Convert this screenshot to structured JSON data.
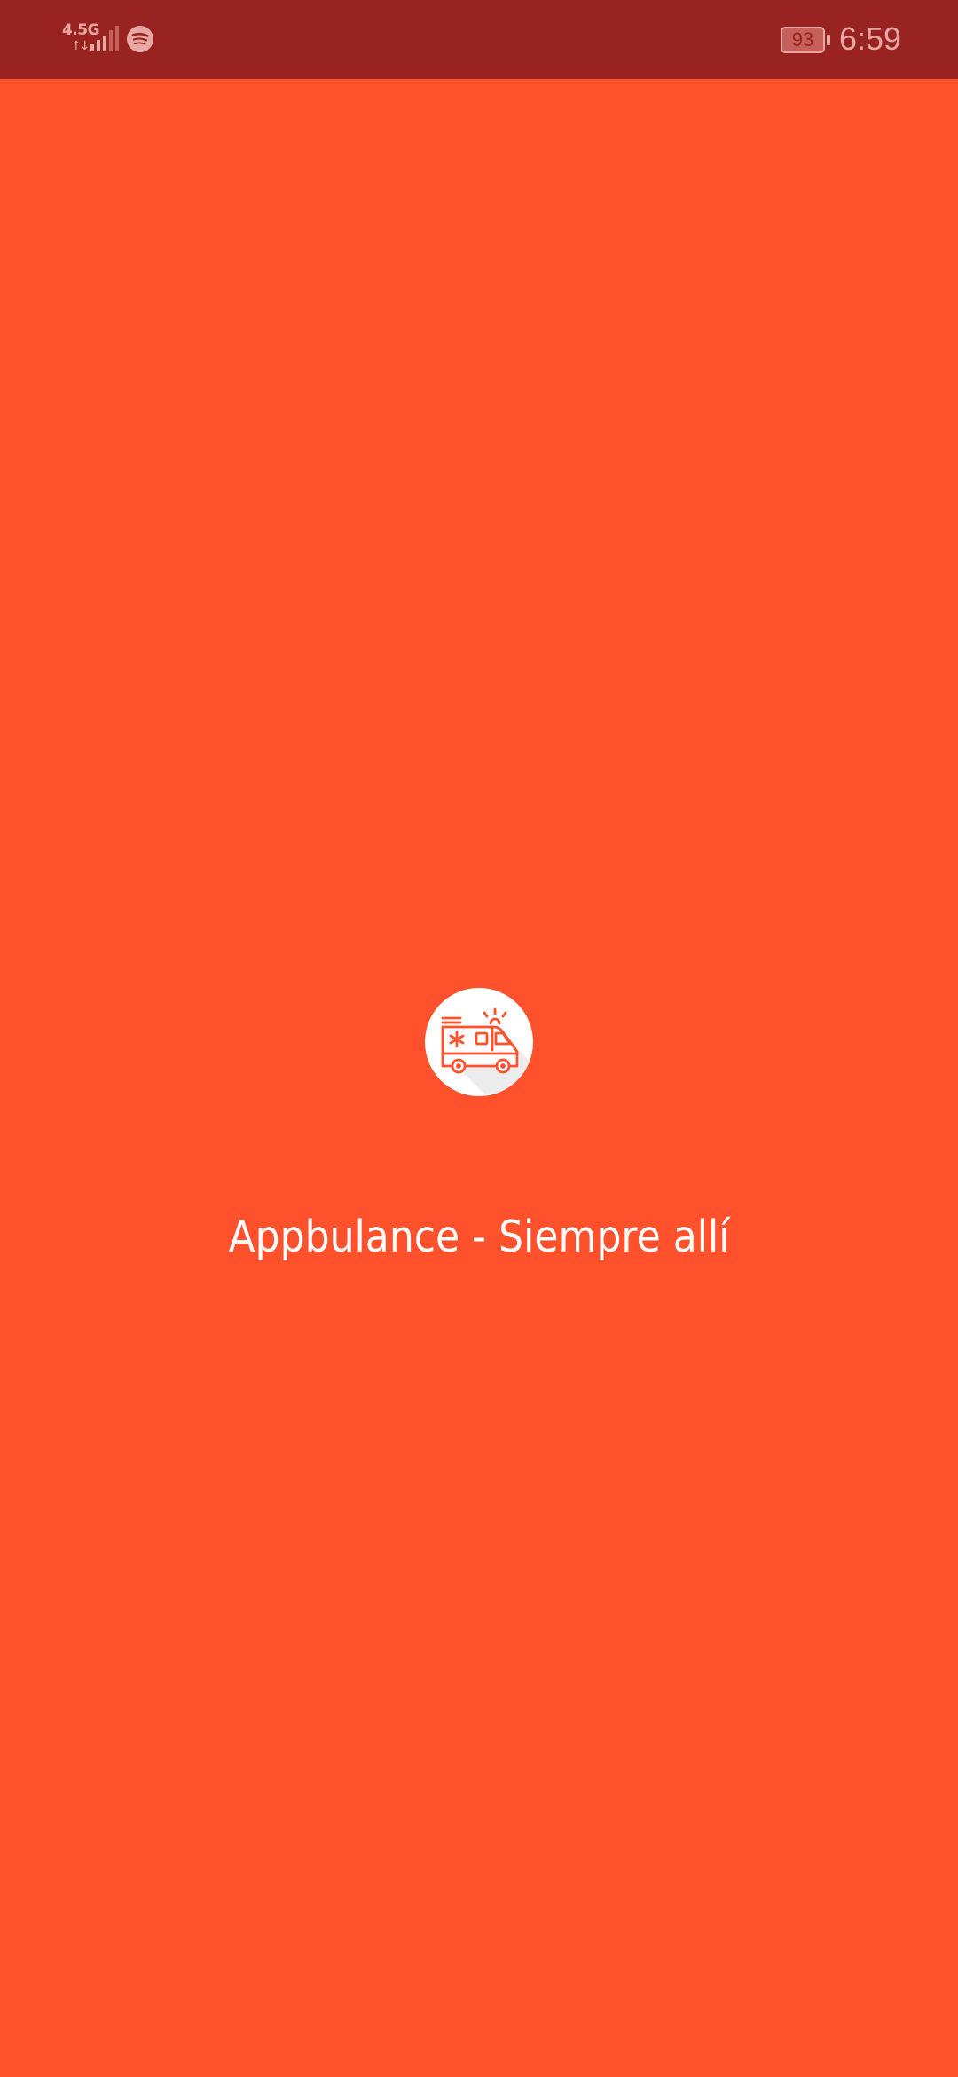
{
  "status_bar": {
    "network_type": "4.5G",
    "data_activity": "↑↓",
    "signal_icon": "cellular-signal-icon",
    "notification_icons": [
      "spotify-icon"
    ],
    "battery_level": "93",
    "time": "6:59"
  },
  "splash": {
    "logo_icon": "ambulance-icon",
    "tagline": "Appbulance - Siempre allí"
  },
  "colors": {
    "background": "#FF512B",
    "status_bar": "#982320",
    "status_text": "#E8A7A2",
    "logo_background": "#FFFFFF",
    "logo_stroke": "#FF512B",
    "text": "#FFFFFF"
  }
}
